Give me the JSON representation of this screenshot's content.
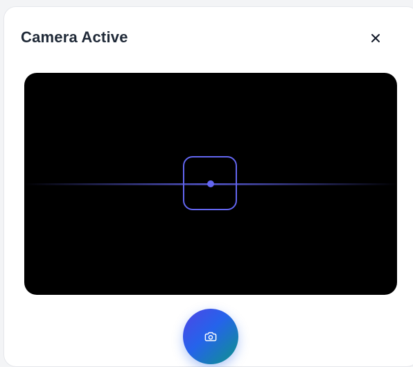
{
  "dialog": {
    "title": "Camera Active"
  },
  "icons": {
    "close": "close-icon",
    "capture": "camera-icon",
    "focus": "focus-reticle-icon"
  },
  "colors": {
    "accent": "#6366f1",
    "viewport_bg": "#000000",
    "title_text": "#1f2937",
    "capture_gradient": [
      "#4f46e5",
      "#2563eb",
      "#0d9488"
    ]
  }
}
